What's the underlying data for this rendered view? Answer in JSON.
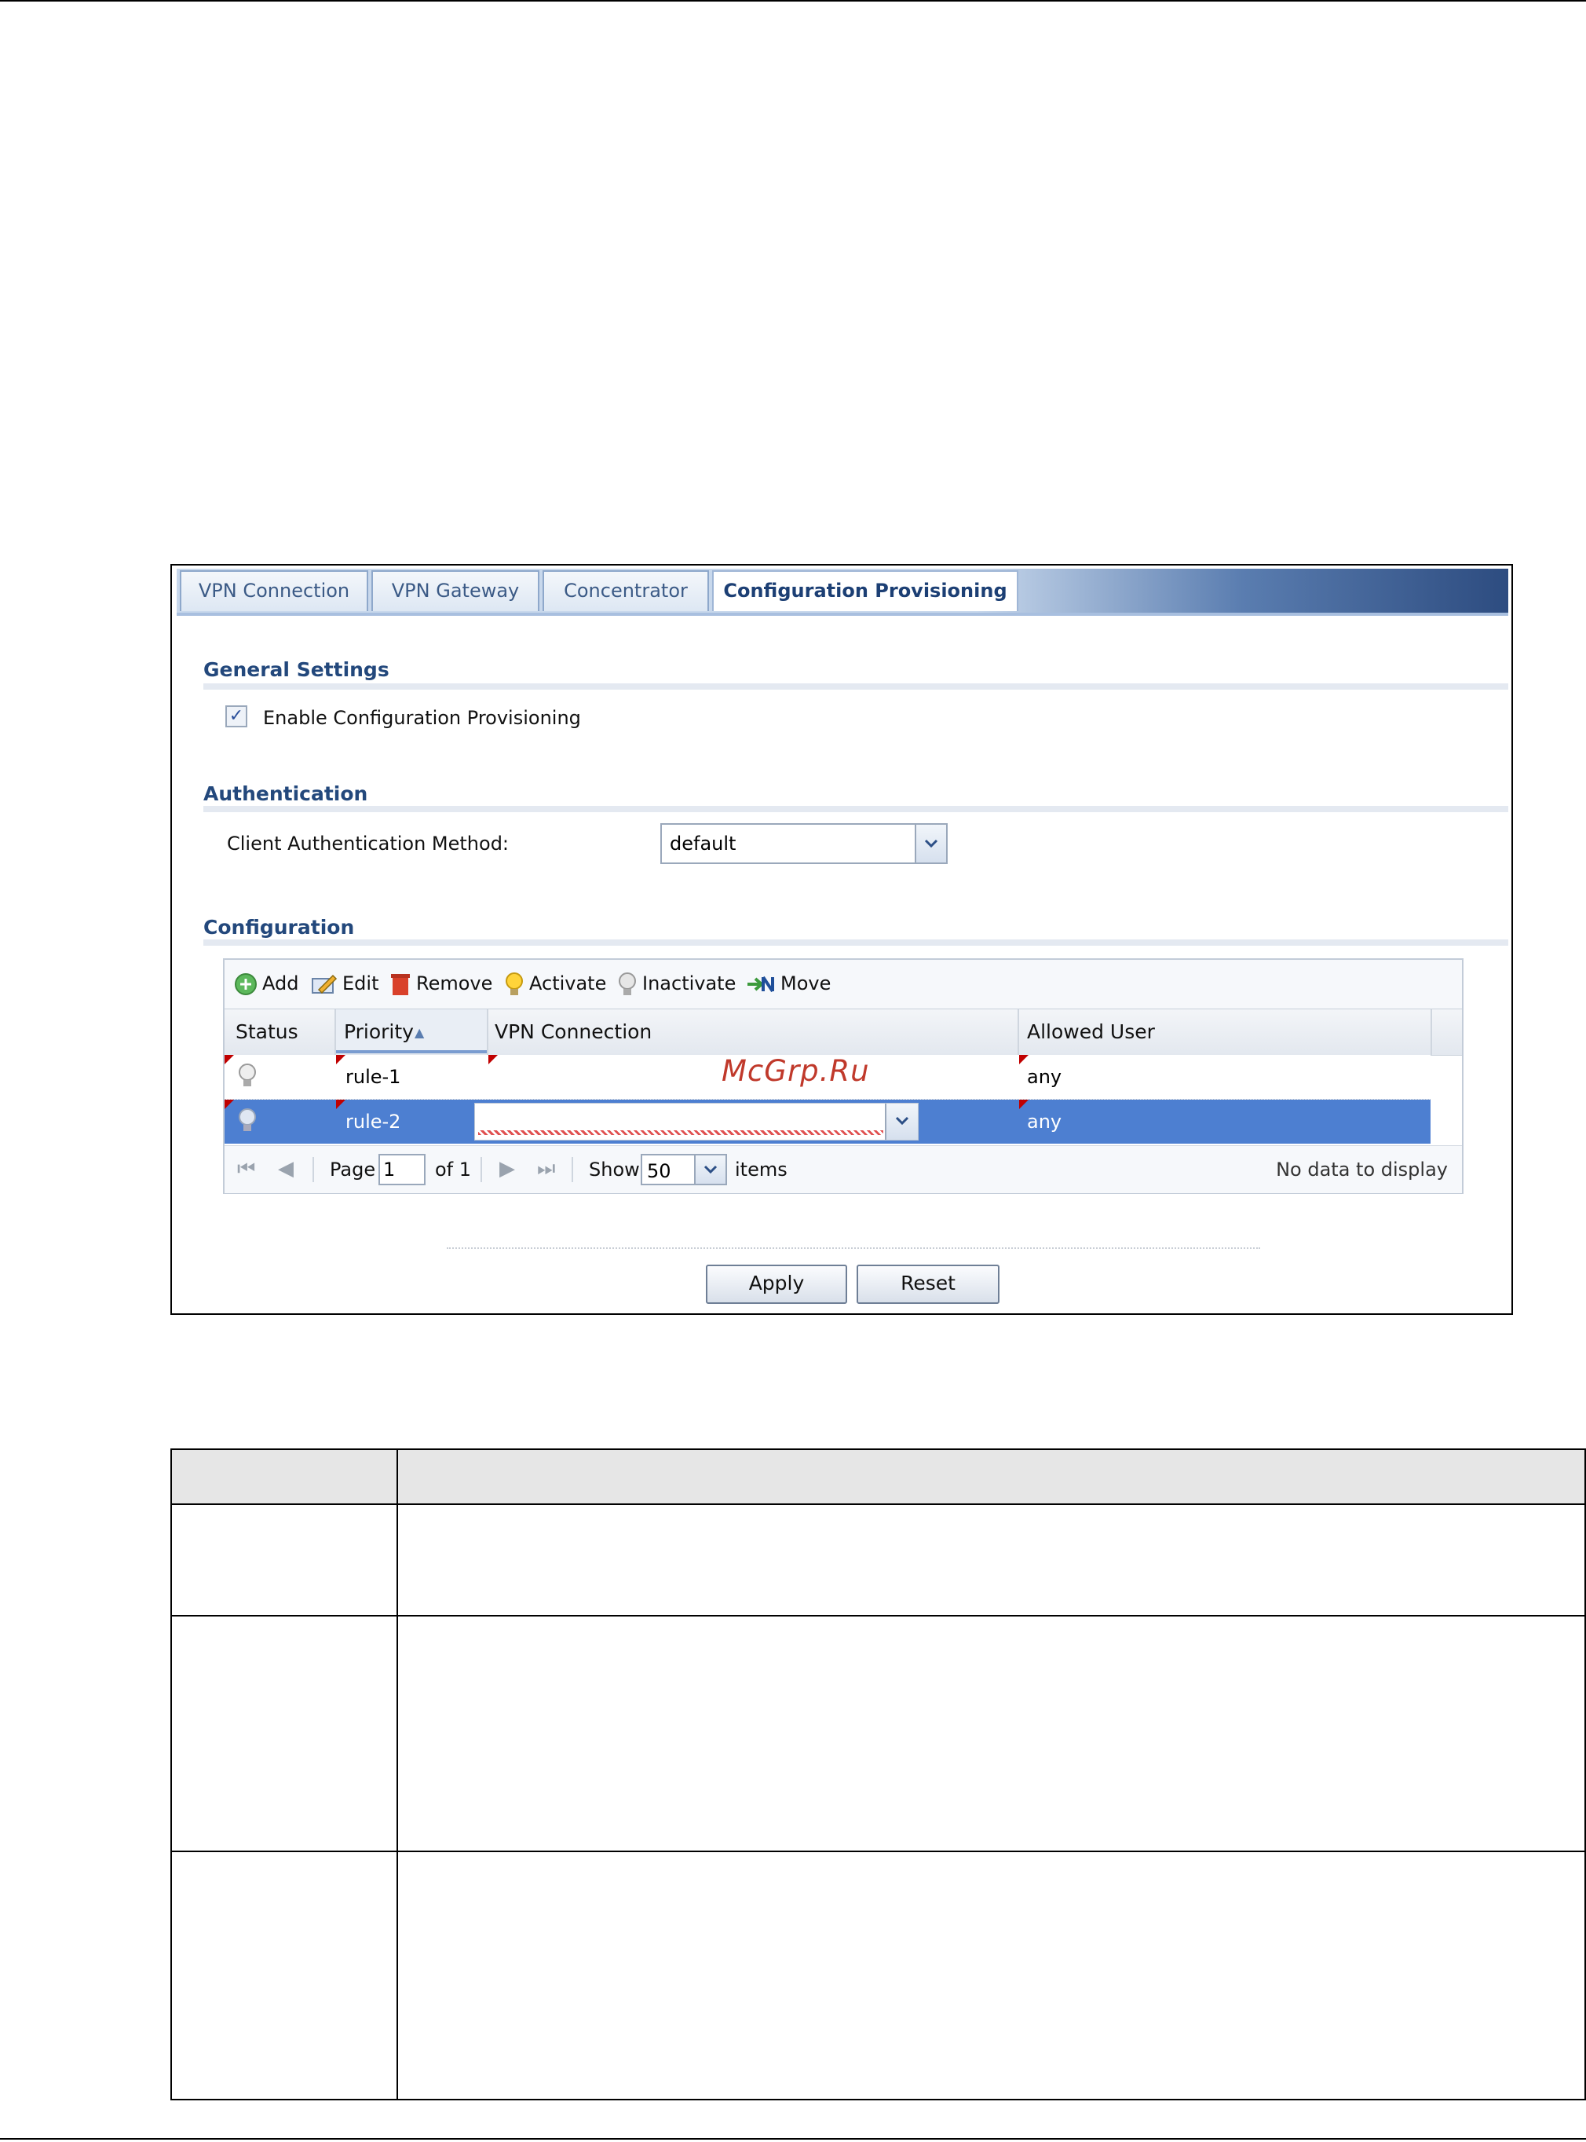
{
  "tabs": [
    {
      "label": "VPN Connection"
    },
    {
      "label": "VPN Gateway"
    },
    {
      "label": "Concentrator"
    },
    {
      "label": "Configuration Provisioning"
    }
  ],
  "general": {
    "title": "General Settings",
    "enable_label": "Enable Configuration Provisioning",
    "enable_checked": true
  },
  "authentication": {
    "title": "Authentication",
    "method_label": "Client Authentication Method:",
    "method_value": "default"
  },
  "configuration": {
    "title": "Configuration",
    "toolbar": {
      "add": "Add",
      "edit": "Edit",
      "remove": "Remove",
      "activate": "Activate",
      "inactivate": "Inactivate",
      "move": "Move"
    },
    "columns": {
      "status": "Status",
      "priority": "Priority",
      "vpn_connection": "VPN Connection",
      "allowed_user": "Allowed User"
    },
    "rows": [
      {
        "priority": "rule-1",
        "vpn_connection": "",
        "allowed_user": "any"
      },
      {
        "priority": "rule-2",
        "vpn_connection": "",
        "allowed_user": "any"
      }
    ],
    "pager": {
      "page_label": "Page",
      "page_value": "1",
      "of_label": "of 1",
      "show_label": "Show",
      "show_value": "50",
      "items_label": "items",
      "empty_text": "No data to display"
    }
  },
  "buttons": {
    "apply": "Apply",
    "reset": "Reset"
  },
  "watermark": "McGrp.Ru",
  "colors": {
    "selected_row": "#4d7fd1",
    "section_title": "#23487c"
  }
}
